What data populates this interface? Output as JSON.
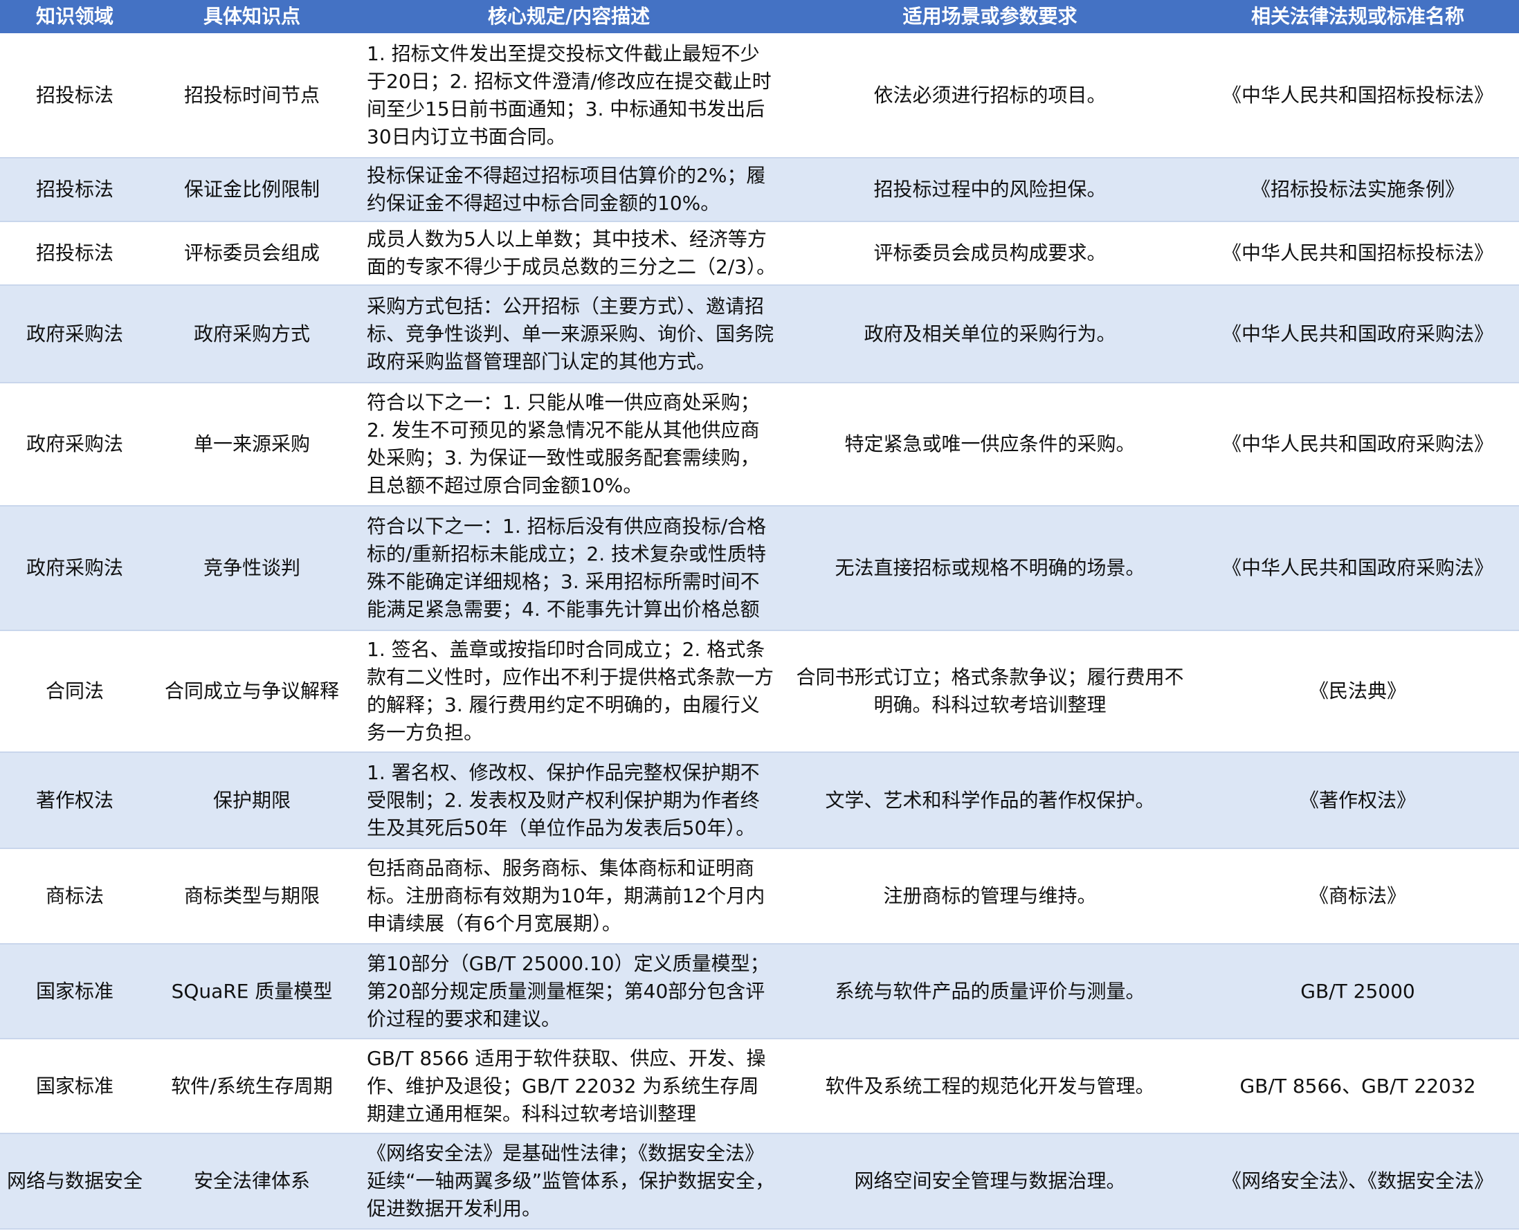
{
  "headers": [
    "知识领域",
    "具体知识点",
    "核心规定/内容描述",
    "适用场景或参数要求",
    "相关法律法规或标准名称"
  ],
  "rows": [
    {
      "domain": "招投标法",
      "topic": "招投标时间节点",
      "desc": "1. 招标文件发出至提交投标文件截止最短不少于20日；2. 招标文件澄清/修改应在提交截止时间至少15日前书面通知；3. 中标通知书发出后30日内订立书面合同。",
      "scene": "依法必须进行招标的项目。",
      "law": "《中华人民共和国招标投标法》"
    },
    {
      "domain": "招投标法",
      "topic": "保证金比例限制",
      "desc": "投标保证金不得超过招标项目估算价的2%；履约保证金不得超过中标合同金额的10%。",
      "scene": "招投标过程中的风险担保。",
      "law": "《招标投标法实施条例》"
    },
    {
      "domain": "招投标法",
      "topic": "评标委员会组成",
      "desc": "成员人数为5人以上单数；其中技术、经济等方面的专家不得少于成员总数的三分之二（2/3）。",
      "scene": "评标委员会成员构成要求。",
      "law": "《中华人民共和国招标投标法》"
    },
    {
      "domain": "政府采购法",
      "topic": "政府采购方式",
      "desc": "采购方式包括：公开招标（主要方式）、邀请招标、竞争性谈判、单一来源采购、询价、国务院政府采购监督管理部门认定的其他方式。",
      "scene": "政府及相关单位的采购行为。",
      "law": "《中华人民共和国政府采购法》"
    },
    {
      "domain": "政府采购法",
      "topic": "单一来源采购",
      "desc": "符合以下之一：1. 只能从唯一供应商处采购；2. 发生不可预见的紧急情况不能从其他供应商处采购；3. 为保证一致性或服务配套需续购，且总额不超过原合同金额10%。",
      "scene": "特定紧急或唯一供应条件的采购。",
      "law": "《中华人民共和国政府采购法》"
    },
    {
      "domain": "政府采购法",
      "topic": "竞争性谈判",
      "desc": "符合以下之一：1. 招标后没有供应商投标/合格标的/重新招标未能成立；2. 技术复杂或性质特殊不能确定详细规格；3. 采用招标所需时间不能满足紧急需要；4. 不能事先计算出价格总额",
      "scene": "无法直接招标或规格不明确的场景。",
      "law": "《中华人民共和国政府采购法》"
    },
    {
      "domain": "合同法",
      "topic": "合同成立与争议解释",
      "desc": "1. 签名、盖章或按指印时合同成立；2. 格式条款有二义性时，应作出不利于提供格式条款一方的解释；3. 履行费用约定不明确的，由履行义务一方负担。",
      "scene": "合同书形式订立；格式条款争议；履行费用不明确。科科过软考培训整理",
      "law": "《民法典》"
    },
    {
      "domain": "著作权法",
      "topic": "保护期限",
      "desc": "1. 署名权、修改权、保护作品完整权保护期不受限制；2. 发表权及财产权利保护期为作者终生及其死后50年（单位作品为发表后50年）。",
      "scene": "文学、艺术和科学作品的著作权保护。",
      "law": "《著作权法》"
    },
    {
      "domain": "商标法",
      "topic": "商标类型与期限",
      "desc": "包括商品商标、服务商标、集体商标和证明商标。注册商标有效期为10年，期满前12个月内申请续展（有6个月宽展期）。",
      "scene": "注册商标的管理与维持。",
      "law": "《商标法》"
    },
    {
      "domain": "国家标准",
      "topic": "SQuaRE 质量模型",
      "desc": "第10部分（GB/T 25000.10）定义质量模型；第20部分规定质量测量框架；第40部分包含评价过程的要求和建议。",
      "scene": "系统与软件产品的质量评价与测量。",
      "law": "GB/T 25000"
    },
    {
      "domain": "国家标准",
      "topic": "软件/系统生存周期",
      "desc": "GB/T 8566 适用于软件获取、供应、开发、操作、维护及退役；GB/T 22032 为系统生存周期建立通用框架。科科过软考培训整理",
      "scene": "软件及系统工程的规范化开发与管理。",
      "law": "GB/T 8566、GB/T 22032"
    },
    {
      "domain": "网络与数据安全",
      "topic": "安全法律体系",
      "desc": "《网络安全法》是基础性法律；《数据安全法》延续“一轴两翼多级”监管体系，保护数据安全，促进数据开发利用。",
      "scene": "网络空间安全管理与数据治理。",
      "law": "《网络安全法》、《数据安全法》"
    }
  ]
}
